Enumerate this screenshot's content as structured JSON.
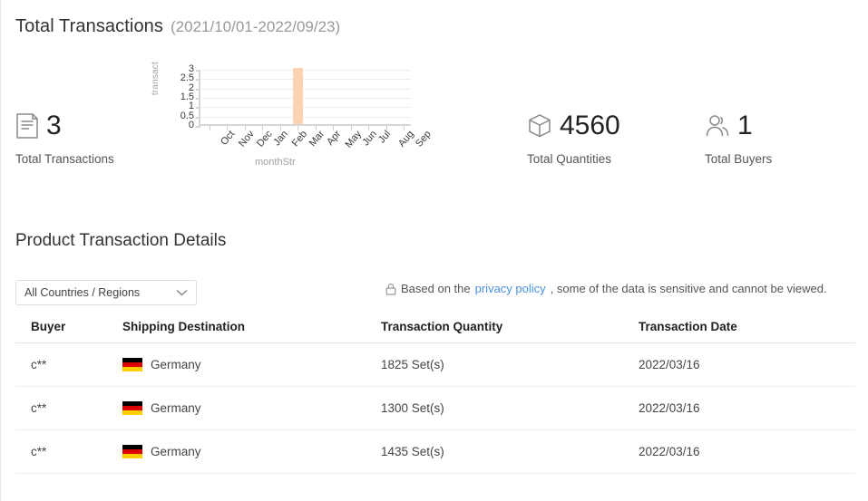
{
  "overview": {
    "title": "Total Transactions",
    "date_range": "(2021/10/01-2022/09/23)"
  },
  "stats": [
    {
      "icon": "document-icon",
      "value": "3",
      "label": "Total Transactions"
    },
    {
      "icon": "box-icon",
      "value": "4560",
      "label": "Total Quantities"
    },
    {
      "icon": "users-icon",
      "value": "1",
      "label": "Total Buyers"
    }
  ],
  "details": {
    "title": "Product Transaction Details",
    "filter": {
      "selected": "All Countries / Regions",
      "icon": "chevron-down-icon"
    },
    "privacy_notice": {
      "icon": "lock-icon",
      "prefix": "Based on the ",
      "link": "privacy policy",
      "suffix": ", some of the data is sensitive and cannot be viewed."
    },
    "table": {
      "columns": [
        "Buyer",
        "Shipping Destination",
        "Transaction Quantity",
        "Transaction Date"
      ],
      "rows": [
        {
          "buyer": "c**",
          "destination": "Germany",
          "flag": "flag-germany",
          "quantity": "1825 Set(s)",
          "date": "2022/03/16"
        },
        {
          "buyer": "c**",
          "destination": "Germany",
          "flag": "flag-germany",
          "quantity": "1300 Set(s)",
          "date": "2022/03/16"
        },
        {
          "buyer": "c**",
          "destination": "Germany",
          "flag": "flag-germany",
          "quantity": "1435 Set(s)",
          "date": "2022/03/16"
        }
      ]
    }
  },
  "chart_data": {
    "type": "bar",
    "title": "",
    "xlabel": "monthStr",
    "ylabel": "transact",
    "categories": [
      "Oct",
      "Nov",
      "Dec",
      "Jan",
      "Feb",
      "Mar",
      "Apr",
      "May",
      "Jun",
      "Jul",
      "Aug",
      "Sep"
    ],
    "values": [
      0,
      0,
      0,
      0,
      0,
      3,
      0,
      0,
      0,
      0,
      0,
      0
    ],
    "ylim": [
      0,
      3
    ],
    "yticks": [
      "0",
      "0.5",
      "1",
      "1.5",
      "2",
      "2.5",
      "3"
    ],
    "grid": true,
    "legend": "none",
    "bar_color": "#fcd3b2"
  },
  "colors": {
    "link": "#4a90e2",
    "bar": "#fcd3b2",
    "flag_black": "#000000",
    "flag_red": "#dd0000",
    "flag_gold": "#ffce00"
  }
}
